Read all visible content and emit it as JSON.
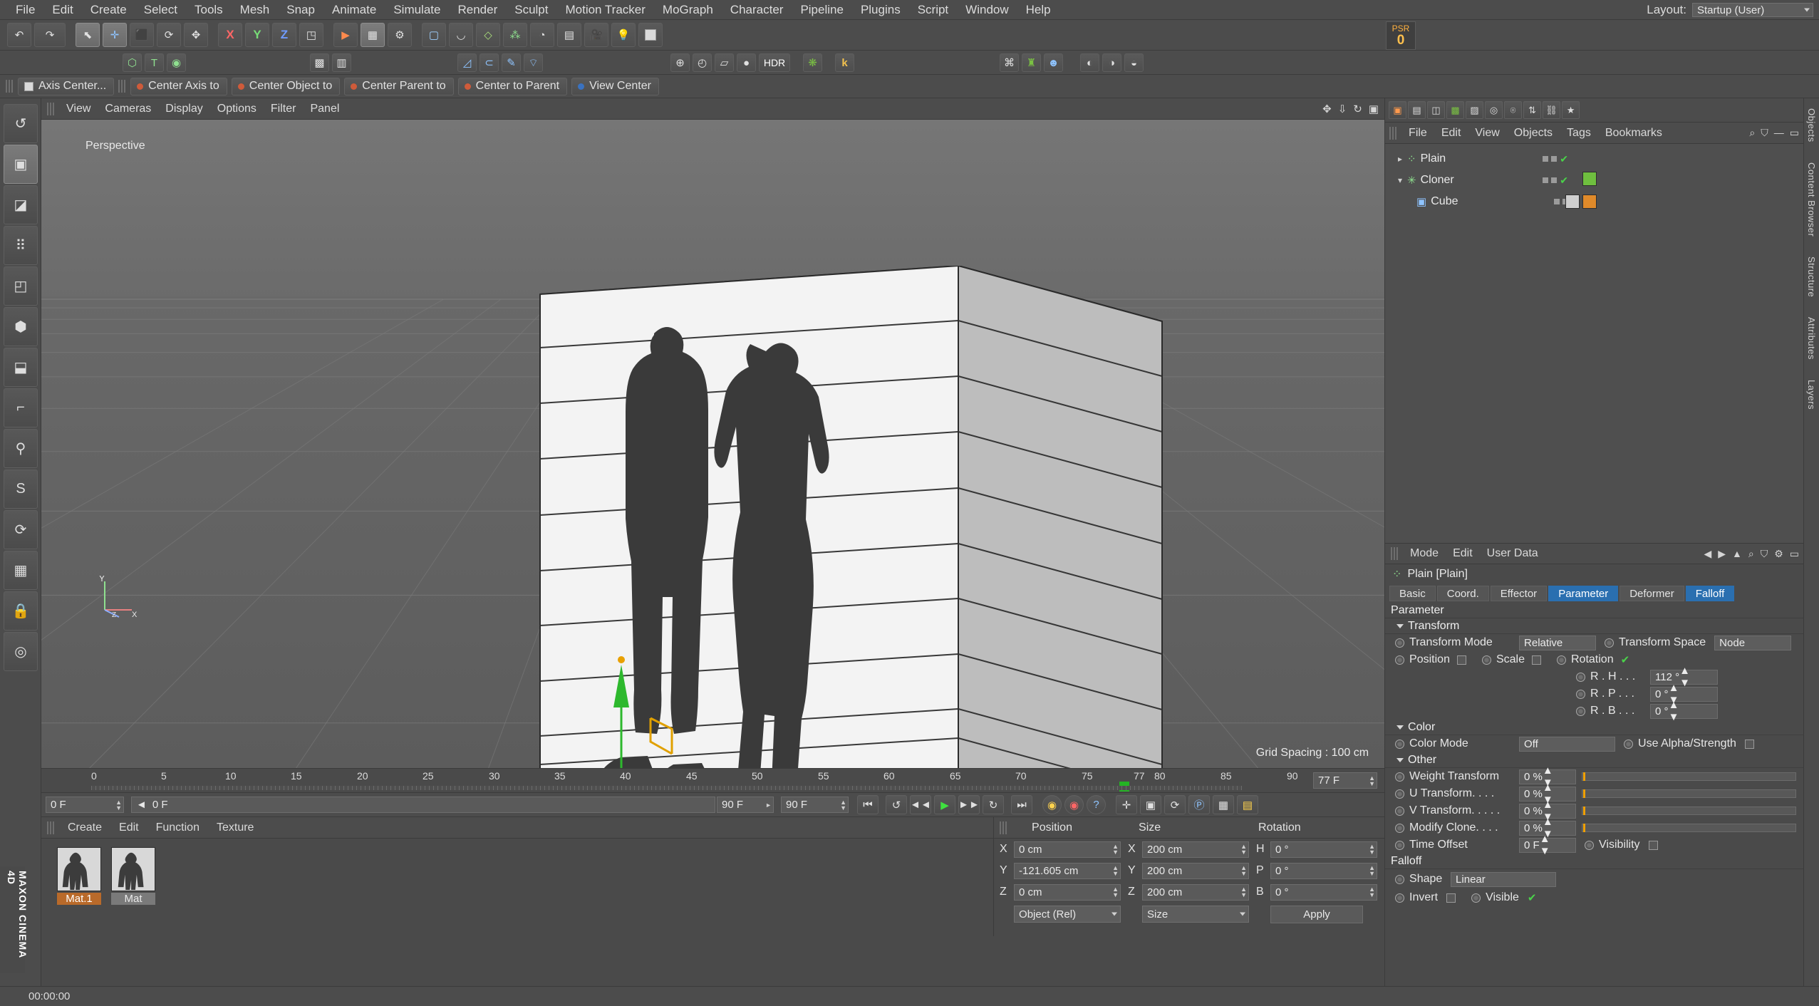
{
  "app": {
    "brand": "MAXON CINEMA 4D"
  },
  "menubar": {
    "items": [
      "File",
      "Edit",
      "Create",
      "Select",
      "Tools",
      "Mesh",
      "Snap",
      "Animate",
      "Simulate",
      "Render",
      "Sculpt",
      "Motion Tracker",
      "MoGraph",
      "Character",
      "Pipeline",
      "Plugins",
      "Script",
      "Window",
      "Help"
    ],
    "layout_label": "Layout:",
    "layout_value": "Startup (User)"
  },
  "psr": {
    "label": "PSR",
    "value": "0"
  },
  "toolbar1": {
    "icons": [
      "undo-icon",
      "redo-icon",
      "select-live-icon",
      "move-icon",
      "scale-icon",
      "rotate-icon",
      "axis-move-icon",
      "x-axis-lock",
      "y-axis-lock",
      "z-axis-lock",
      "world-axis-icon",
      "render-view-icon",
      "render-region-icon",
      "render-settings-icon",
      "cube-primitive-icon",
      "spline-pen-icon",
      "nurbs-icon",
      "mograph-cloner-icon",
      "deformer-icon",
      "environment-icon",
      "camera-icon",
      "light-icon",
      "material-icon"
    ],
    "labels": {
      "x": "X",
      "y": "Y",
      "z": "Z",
      "hdr": "HDR",
      "k": "k"
    }
  },
  "toolbar2": {
    "icons": [
      "make-editable-icon",
      "model-mode-icon",
      "texture-mode-icon",
      "points-mode-icon",
      "workplane-icon",
      "snap-icon",
      "quantize-icon",
      "knife-icon",
      "bridge-icon",
      "brush-icon",
      "iron-icon",
      "scene-nodes-icon",
      "takes-icon",
      "layers-icon",
      "content-browser-icon"
    ]
  },
  "modebar": {
    "axis_center": "Axis Center...",
    "items": [
      "Center Axis to",
      "Center Object to",
      "Center Parent to",
      "Center to Parent",
      "View Center"
    ]
  },
  "viewport": {
    "menu": [
      "View",
      "Cameras",
      "Display",
      "Options",
      "Filter",
      "Panel"
    ],
    "label": "Perspective",
    "grid_spacing": "Grid Spacing : 100 cm",
    "axis_labels": {
      "y": "Y",
      "x": "X",
      "z": "Z"
    }
  },
  "timeline": {
    "ticks": [
      "0",
      "5",
      "10",
      "15",
      "20",
      "25",
      "30",
      "35",
      "40",
      "45",
      "50",
      "55",
      "60",
      "65",
      "70",
      "75",
      "80",
      "85",
      "90"
    ],
    "current_marker": "77",
    "frame_field": "77 F"
  },
  "player": {
    "start_field": "0 F",
    "current_field": "0 F",
    "end_field": "90 F",
    "max_field": "90 F",
    "buttons": [
      "go-to-start-icon",
      "play-reverse-icon",
      "step-back-icon",
      "play-icon",
      "step-forward-icon",
      "loop-icon",
      "go-to-end-icon",
      "record-icon",
      "autokey-icon",
      "keyframe-help-icon",
      "record-position-icon",
      "record-scale-icon",
      "record-rotation-icon",
      "record-pla-icon",
      "record-param-icon",
      "dope-sheet-icon"
    ]
  },
  "material_manager": {
    "menu": [
      "Create",
      "Edit",
      "Function",
      "Texture"
    ],
    "materials": [
      {
        "name": "Mat.1",
        "selected": true
      },
      {
        "name": "Mat",
        "selected": false
      }
    ]
  },
  "coordinates": {
    "headers": [
      "Position",
      "Size",
      "Rotation"
    ],
    "rows": [
      {
        "axis": "X",
        "position": "0 cm",
        "size_axis": "X",
        "size": "200 cm",
        "rot_axis": "H",
        "rotation": "0 °"
      },
      {
        "axis": "Y",
        "position": "-121.605 cm",
        "size_axis": "Y",
        "size": "200 cm",
        "rot_axis": "P",
        "rotation": "0 °"
      },
      {
        "axis": "Z",
        "position": "0 cm",
        "size_axis": "Z",
        "size": "200 cm",
        "rot_axis": "B",
        "rotation": "0 °"
      }
    ],
    "mode_value": "Object (Rel)",
    "size_value": "Size",
    "apply_label": "Apply"
  },
  "object_manager": {
    "menu": [
      "File",
      "Edit",
      "View",
      "Objects",
      "Tags",
      "Bookmarks"
    ],
    "tree": [
      {
        "name": "Plain",
        "indent": 0,
        "icon": "mograph-plain-effector-icon"
      },
      {
        "name": "Cloner",
        "indent": 0,
        "icon": "mograph-cloner-icon"
      },
      {
        "name": "Cube",
        "indent": 1,
        "icon": "cube-object-icon"
      }
    ]
  },
  "attribute_manager": {
    "menu": [
      "Mode",
      "Edit",
      "User Data"
    ],
    "title": "Plain [Plain]",
    "tabs": [
      {
        "label": "Basic",
        "selected": false
      },
      {
        "label": "Coord.",
        "selected": false
      },
      {
        "label": "Effector",
        "selected": false
      },
      {
        "label": "Parameter",
        "selected": true
      },
      {
        "label": "Deformer",
        "selected": false
      },
      {
        "label": "Falloff",
        "selected": true
      }
    ],
    "sections": {
      "parameter": "Parameter",
      "transform": "Transform",
      "color": "Color",
      "other": "Other",
      "falloff": "Falloff"
    },
    "fields": {
      "transform_mode_label": "Transform Mode",
      "transform_mode_value": "Relative",
      "transform_space_label": "Transform Space",
      "transform_space_value": "Node",
      "position_label": "Position",
      "scale_label": "Scale",
      "rotation_label": "Rotation",
      "rotation_checked": true,
      "rh_label": "R . H . . .",
      "rh_value": "112 °",
      "rp_label": "R . P . . .",
      "rp_value": "0 °",
      "rb_label": "R . B . . .",
      "rb_value": "0 °",
      "color_mode_label": "Color Mode",
      "color_mode_value": "Off",
      "use_alpha_label": "Use Alpha/Strength",
      "weight_transform_label": "Weight Transform",
      "weight_transform_value": "0 %",
      "u_transform_label": "U Transform. . . .",
      "u_transform_value": "0 %",
      "v_transform_label": "V Transform. . . . .",
      "v_transform_value": "0 %",
      "modify_clone_label": "Modify Clone. . . .",
      "modify_clone_value": "0 %",
      "time_offset_label": "Time Offset",
      "time_offset_value": "0 F",
      "visibility_label": "Visibility",
      "shape_label": "Shape",
      "shape_value": "Linear",
      "invert_label": "Invert",
      "visible_label": "Visible",
      "visible_checked": true
    }
  },
  "right_strip": {
    "tabs": [
      "Objects",
      "Content Browser",
      "Structure",
      "Attributes",
      "Layers"
    ]
  },
  "statusbar": {
    "time": "00:00:00"
  },
  "colors": {
    "panel": "#4a4a4a",
    "toolbar": "#4c4c4c",
    "accent_blue": "#2a6fb0",
    "accent_orange": "#b96a2a",
    "axis_x": "#ff6666",
    "axis_y": "#77dd77",
    "axis_z": "#6f9bff",
    "green_check": "#4ad24a",
    "psr_orange": "#ffb13f"
  }
}
